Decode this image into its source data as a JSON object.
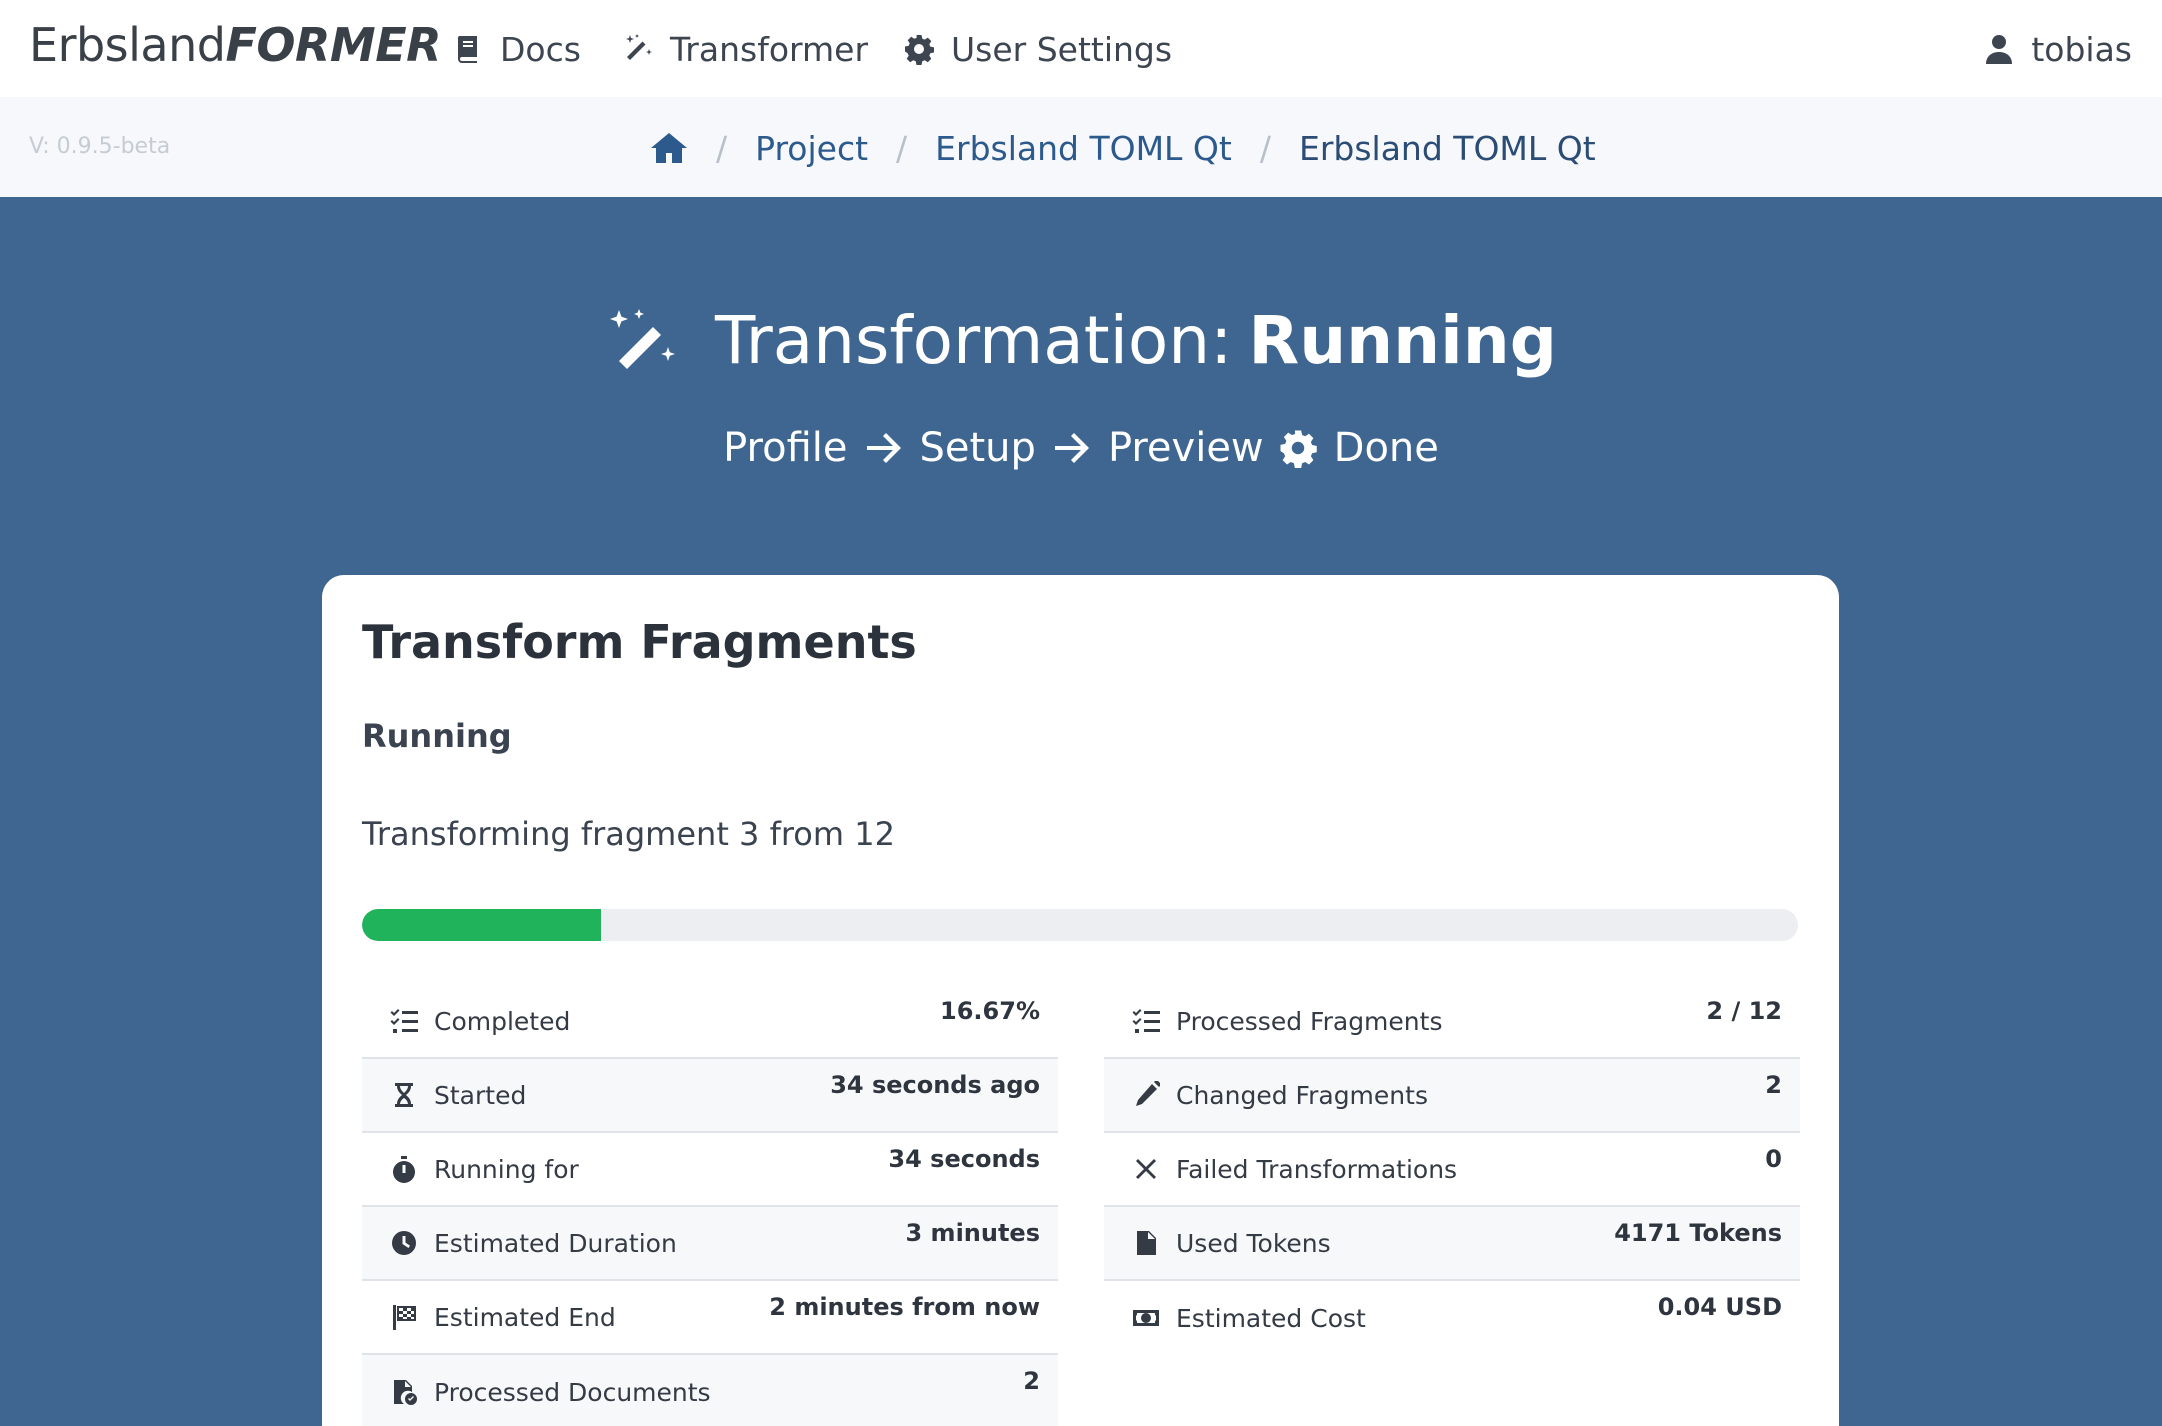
{
  "brand": {
    "part1": "Erbsland",
    "part2": "FORMER"
  },
  "nav": {
    "docs": "Docs",
    "transformer": "Transformer",
    "settings": "User Settings",
    "user": "tobias"
  },
  "version": "V: 0.9.5-beta",
  "breadcrumb": [
    "Project",
    "Erbsland TOML Qt",
    "Erbsland TOML Qt"
  ],
  "hero": {
    "title_prefix": "Transformation:",
    "title_status": "Running",
    "steps": [
      "Profile",
      "Setup",
      "Preview",
      "Done"
    ]
  },
  "card": {
    "title": "Transform Fragments",
    "status": "Running",
    "description": "Transforming fragment 3 from 12",
    "progress_percent": 16.67
  },
  "stats_left": [
    {
      "icon": "checklist-icon",
      "label": "Completed",
      "value": "16.67%"
    },
    {
      "icon": "hourglass-icon",
      "label": "Started",
      "value": "34 seconds ago"
    },
    {
      "icon": "stopwatch-icon",
      "label": "Running for",
      "value": "34 seconds"
    },
    {
      "icon": "clock-icon",
      "label": "Estimated Duration",
      "value": "3 minutes"
    },
    {
      "icon": "checkered-flag-icon",
      "label": "Estimated End",
      "value": "2 minutes from now"
    },
    {
      "icon": "file-check-icon",
      "label": "Processed Documents",
      "value": "2"
    }
  ],
  "stats_right": [
    {
      "icon": "checklist-icon",
      "label": "Processed Fragments",
      "value": "2 / 12"
    },
    {
      "icon": "pencil-icon",
      "label": "Changed Fragments",
      "value": "2"
    },
    {
      "icon": "x-mark-icon",
      "label": "Failed Transformations",
      "value": "0"
    },
    {
      "icon": "file-icon",
      "label": "Used Tokens",
      "value": "4171 Tokens"
    },
    {
      "icon": "money-bill-icon",
      "label": "Estimated Cost",
      "value": "0.04 USD"
    }
  ]
}
